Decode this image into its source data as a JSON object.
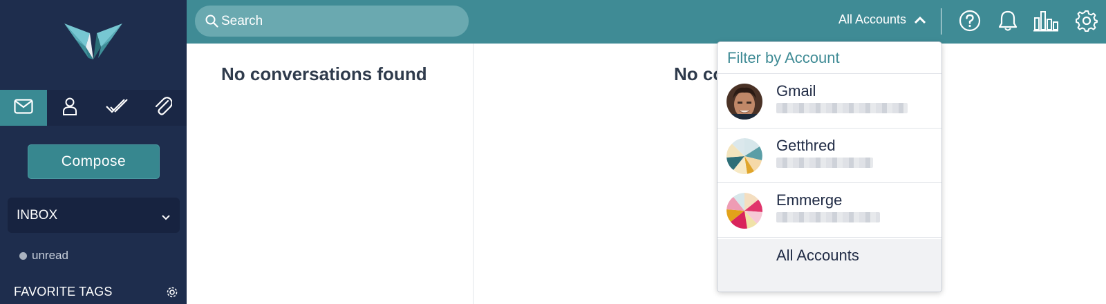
{
  "sidebar": {
    "nav_icons": [
      "mail-icon",
      "person-icon",
      "checkmark-icon",
      "paperclip-icon"
    ],
    "compose_label": "Compose",
    "folder_label": "INBOX",
    "tags": [
      {
        "label": "unread"
      }
    ],
    "favorite_tags_label": "FAVORITE TAGS"
  },
  "topbar": {
    "search_placeholder": "Search",
    "accounts_label": "All Accounts",
    "icons": [
      "help-icon",
      "bell-icon",
      "analytics-icon",
      "gear-icon"
    ]
  },
  "main": {
    "left_empty": "No conversations found",
    "right_empty": "No conversations found"
  },
  "dropdown": {
    "title": "Filter by Account",
    "items": [
      {
        "name": "Gmail"
      },
      {
        "name": "Getthred"
      },
      {
        "name": "Emmerge"
      }
    ],
    "all_label": "All Accounts"
  },
  "colors": {
    "sidebar_bg": "#1e2d4d",
    "accent_teal": "#3f8b95",
    "compose_bg": "#37878f",
    "text_dark": "#2f3b4c"
  }
}
